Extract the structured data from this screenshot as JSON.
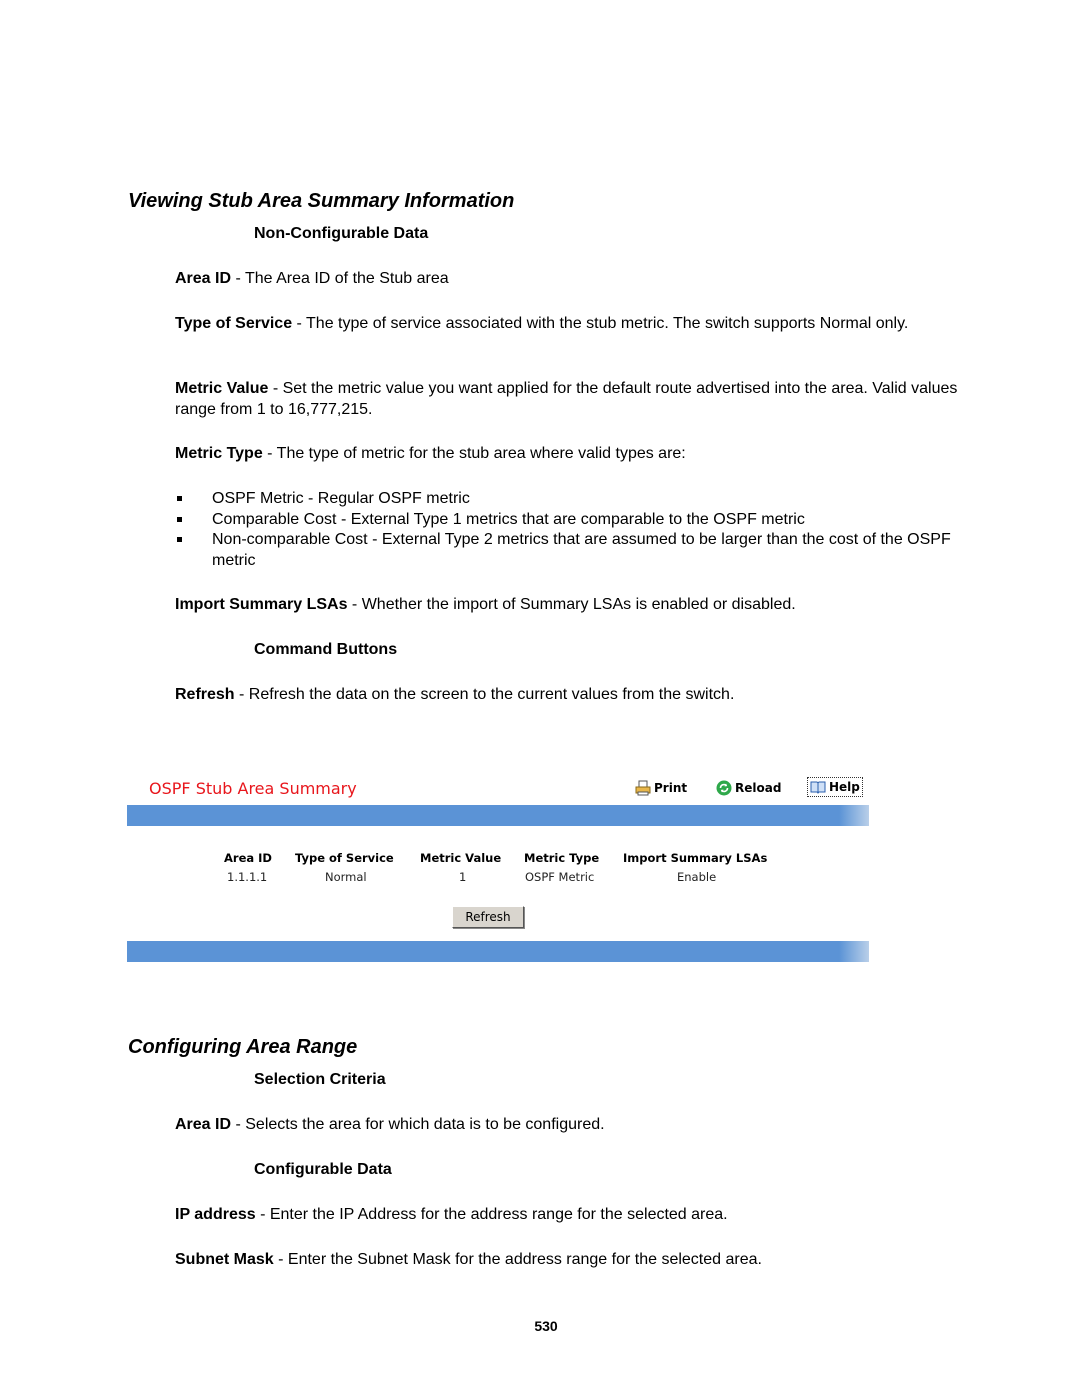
{
  "section1": {
    "title": "Viewing Stub Area Summary Information",
    "noncfg_heading": "Non-Configurable Data",
    "fields": [
      {
        "term": "Area ID",
        "desc": " - The Area ID of the Stub area"
      },
      {
        "term": "Type of Service",
        "desc": " - The type of service associated with the stub metric. The switch supports Normal only."
      },
      {
        "term": "Metric Value",
        "desc": " - Set the metric value you want applied for the default route advertised into the area. Valid values range from 1 to 16,777,215."
      },
      {
        "term": "Metric Type",
        "desc": " - The type of metric for the stub area where valid types are:"
      }
    ],
    "metric_types": [
      "OSPF Metric - Regular OSPF metric",
      "Comparable Cost - External Type 1 metrics that are comparable to the OSPF metric",
      "Non-comparable Cost - External Type 2 metrics that are assumed to be larger than the cost of the OSPF metric"
    ],
    "import_field": {
      "term": "Import Summary LSAs",
      "desc": " - Whether the import of Summary LSAs is enabled or disabled."
    },
    "cmd_heading": "Command Buttons",
    "refresh_field": {
      "term": "Refresh",
      "desc": " - Refresh the data on the screen to the current values from the switch."
    }
  },
  "panel": {
    "title": "OSPF Stub Area Summary",
    "toolbar": {
      "print": "Print",
      "reload": "Reload",
      "help": "Help"
    },
    "columns": [
      "Area ID",
      "Type of Service",
      "Metric Value",
      "Metric Type",
      "Import Summary LSAs"
    ],
    "rows": [
      [
        "1.1.1.1",
        "Normal",
        "1",
        "OSPF Metric",
        "Enable"
      ]
    ],
    "refresh_button": "Refresh",
    "colors": {
      "title": "#e8161c",
      "bar": "#5b93d6",
      "button": "#d9d5ce"
    }
  },
  "section2": {
    "title": "Configuring Area Range",
    "selection_heading": "Selection Criteria",
    "area_field": {
      "term": "Area ID",
      "desc": " - Selects the area for which data is to be configured."
    },
    "cfg_heading": "Configurable Data",
    "ip_field": {
      "term": "IP address",
      "desc": " - Enter the IP Address for the address range for the selected area."
    },
    "mask_field": {
      "term": "Subnet Mask",
      "desc": " - Enter the Subnet Mask for the address range for the selected area."
    }
  },
  "page_number": "530"
}
